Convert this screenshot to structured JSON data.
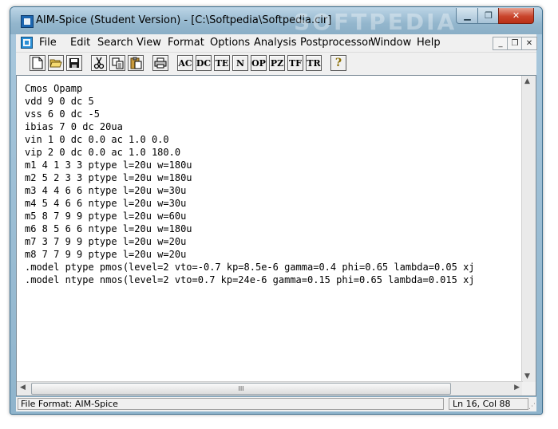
{
  "window": {
    "title": "AIM-Spice (Student Version) - [C:\\Softpedia\\Softpedia.cir]",
    "watermark": "SOFTPEDIA",
    "min_glyph": "▁",
    "max_glyph": "❐",
    "close_glyph": "✕"
  },
  "menubar": {
    "items": [
      "File",
      "Edit",
      "Search",
      "View",
      "Format",
      "Options",
      "Analysis",
      "Postprocessor",
      "Window",
      "Help"
    ],
    "mdi_min": "_",
    "mdi_restore": "❐",
    "mdi_close": "✕"
  },
  "toolbar": {
    "analysis_labels": [
      "AC",
      "DC",
      "TE",
      "N",
      "OP",
      "PZ",
      "TF",
      "TR"
    ],
    "help_glyph": "?"
  },
  "editor": {
    "lines": [
      "Cmos Opamp",
      "vdd 9 0 dc 5",
      "vss 6 0 dc -5",
      "ibias 7 0 dc 20ua",
      "vin 1 0 dc 0.0 ac 1.0 0.0",
      "vip 2 0 dc 0.0 ac 1.0 180.0",
      "m1 4 1 3 3 ptype l=20u w=180u",
      "m2 5 2 3 3 ptype l=20u w=180u",
      "m3 4 4 6 6 ntype l=20u w=30u",
      "m4 5 4 6 6 ntype l=20u w=30u",
      "m5 8 7 9 9 ptype l=20u w=60u",
      "m6 8 5 6 6 ntype l=20u w=180u",
      "m7 3 7 9 9 ptype l=20u w=20u",
      "m8 7 7 9 9 ptype l=20u w=20u",
      ".model ptype pmos(level=2 vto=-0.7 kp=8.5e-6 gamma=0.4 phi=0.65 lambda=0.05 xj",
      ".model ntype nmos(level=2 vto=0.7 kp=24e-6 gamma=0.15 phi=0.65 lambda=0.015 xj"
    ],
    "scroll_up": "▲",
    "scroll_down": "▼",
    "scroll_left": "◀",
    "scroll_right": "▶",
    "thumb_grip": "III"
  },
  "statusbar": {
    "file_format": "File Format: AIM-Spice",
    "position": "Ln 16, Col 88",
    "grip": "⋰"
  }
}
